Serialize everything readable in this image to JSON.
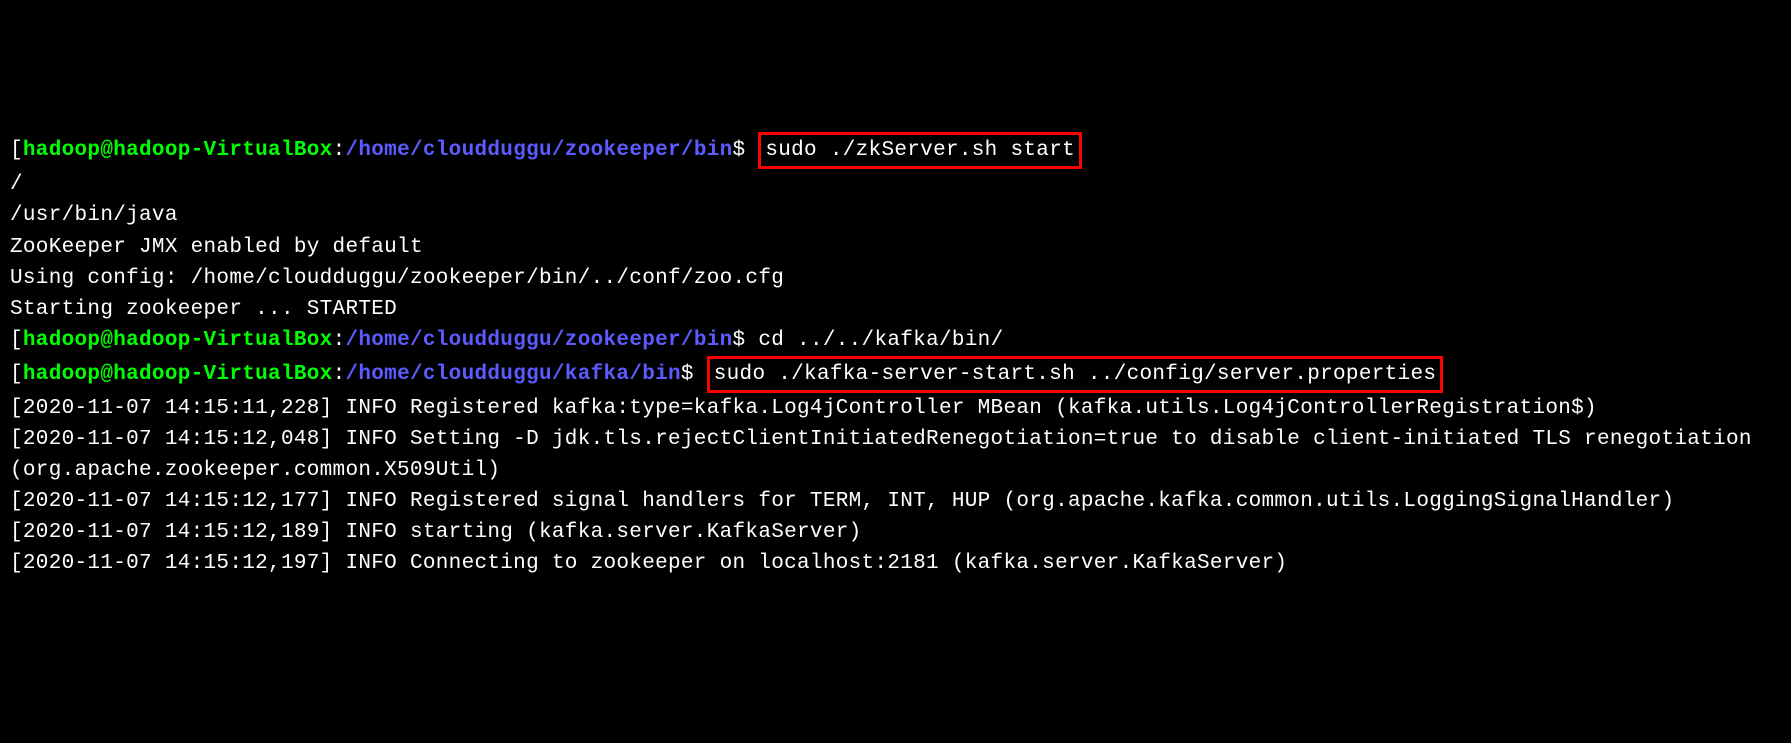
{
  "prompt1": {
    "open_bracket": "[",
    "user_host": "hadoop@hadoop-VirtualBox",
    "colon": ":",
    "path": "/home/cloudduggu/zookeeper/bin",
    "close_bracket_dollar": "$ ",
    "command": "sudo ./zkServer.sh start"
  },
  "output1": {
    "line1": "/",
    "line2": "/usr/bin/java",
    "line3": "ZooKeeper JMX enabled by default",
    "line4": "Using config: /home/cloudduggu/zookeeper/bin/../conf/zoo.cfg",
    "line5": "Starting zookeeper ... STARTED"
  },
  "prompt2": {
    "open_bracket": "[",
    "user_host": "hadoop@hadoop-VirtualBox",
    "colon": ":",
    "path": "/home/cloudduggu/zookeeper/bin",
    "close_bracket_dollar": "$ ",
    "command": "cd ../../kafka/bin/"
  },
  "prompt3": {
    "open_bracket": "[",
    "user_host": "hadoop@hadoop-VirtualBox",
    "colon": ":",
    "path": "/home/cloudduggu/kafka/bin",
    "close_bracket_dollar": "$ ",
    "command": "sudo ./kafka-server-start.sh ../config/server.properties"
  },
  "output2": {
    "line1": "[2020-11-07 14:15:11,228] INFO Registered kafka:type=kafka.Log4jController MBean (kafka.utils.Log4jControllerRegistration$)",
    "line2": "[2020-11-07 14:15:12,048] INFO Setting -D jdk.tls.rejectClientInitiatedRenegotiation=true to disable client-initiated TLS renegotiation (org.apache.zookeeper.common.X509Util)",
    "line3": "[2020-11-07 14:15:12,177] INFO Registered signal handlers for TERM, INT, HUP (org.apache.kafka.common.utils.LoggingSignalHandler)",
    "line4": "[2020-11-07 14:15:12,189] INFO starting (kafka.server.KafkaServer)",
    "line5": "[2020-11-07 14:15:12,197] INFO Connecting to zookeeper on localhost:2181 (kafka.server.KafkaServer)"
  }
}
